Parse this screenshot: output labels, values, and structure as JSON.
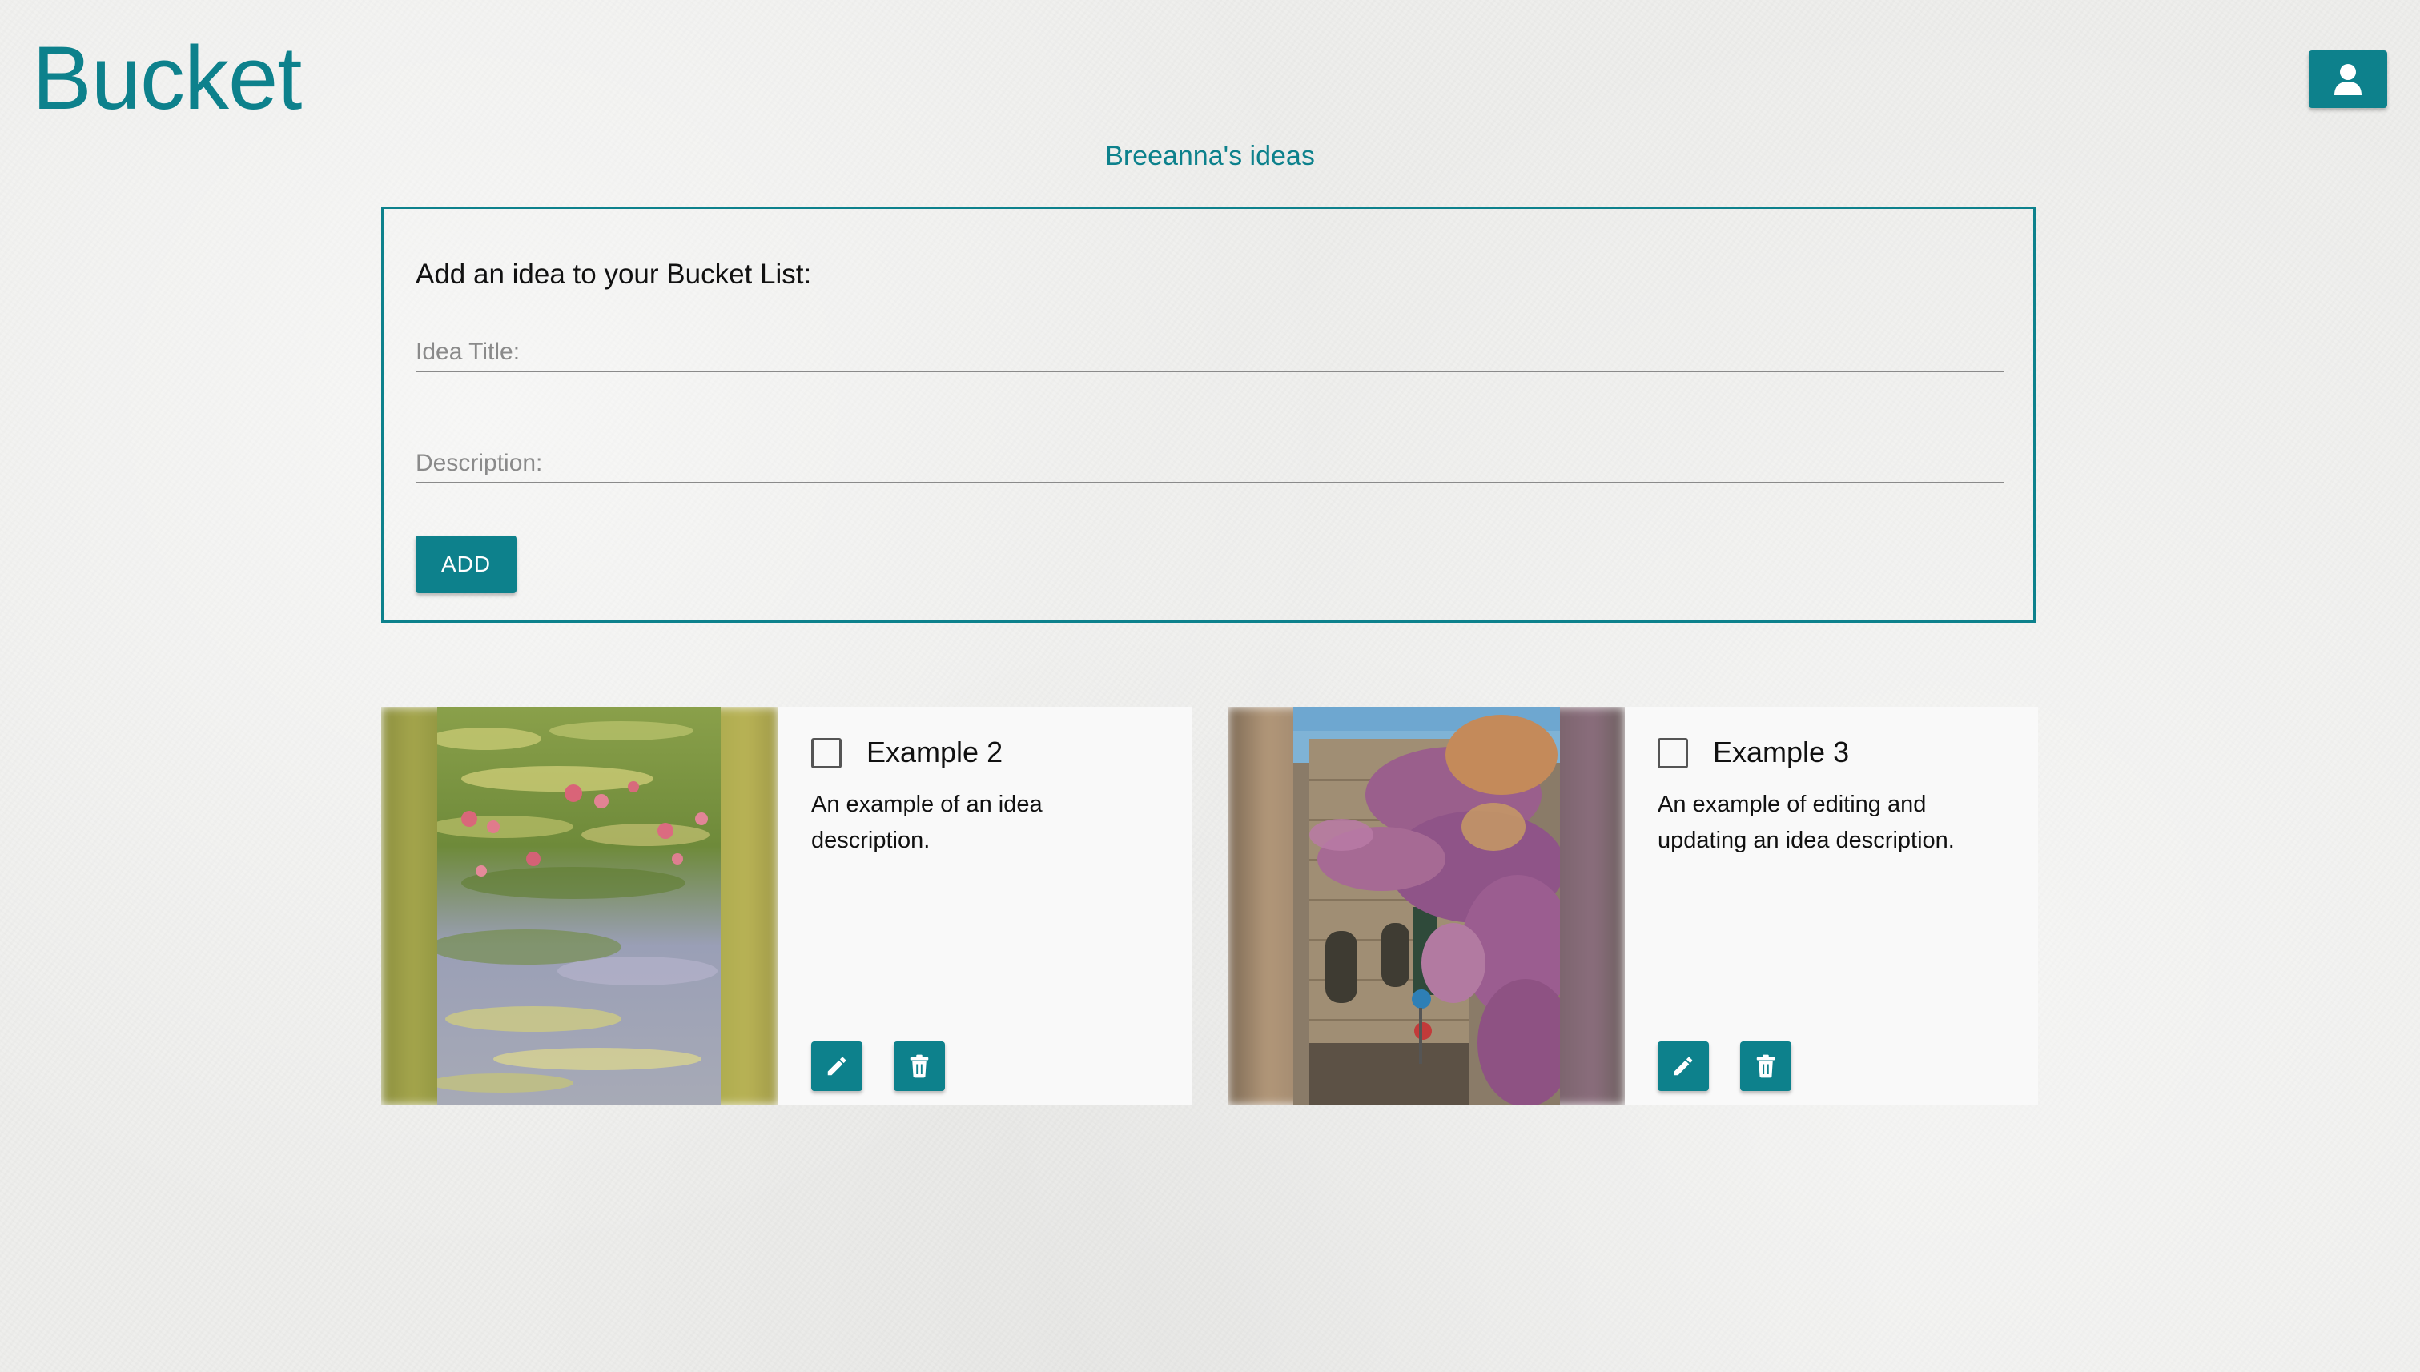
{
  "header": {
    "logo_text": "Bucket",
    "account_icon": "user-icon"
  },
  "page": {
    "title": "Breeanna's ideas"
  },
  "add_form": {
    "heading": "Add an idea to your Bucket List:",
    "title_placeholder": "Idea Title:",
    "title_value": "",
    "description_placeholder": "Description:",
    "description_value": "",
    "add_label": "ADD"
  },
  "ideas": [
    {
      "title": "Example 2",
      "description": "An example of an idea description.",
      "checked": false,
      "image": "water-lilies-painting",
      "edit_icon": "pencil-icon",
      "delete_icon": "trash-icon"
    },
    {
      "title": "Example 3",
      "description": "An example of editing and updating an idea description.",
      "checked": false,
      "image": "stone-building-with-flowers",
      "edit_icon": "pencil-icon",
      "delete_icon": "trash-icon"
    }
  ],
  "colors": {
    "accent": "#0d818c",
    "card_background": "#f9f9f9",
    "page_background": "#eeeeec"
  }
}
